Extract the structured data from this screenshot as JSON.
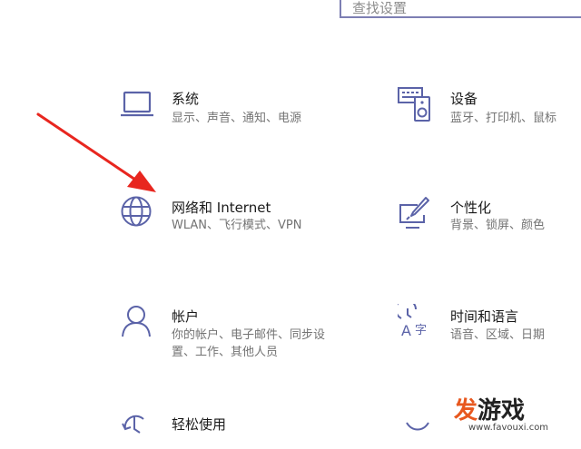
{
  "search": {
    "placeholder": "查找设置"
  },
  "tiles": [
    {
      "title": "系统",
      "desc": [
        "显示、声音、通知、电源"
      ]
    },
    {
      "title": "设备",
      "desc": [
        "蓝牙、打印机、鼠标"
      ]
    },
    {
      "title": "网络和 Internet",
      "desc": [
        "WLAN、飞行模式、VPN"
      ]
    },
    {
      "title": "个性化",
      "desc": [
        "背景、锁屏、颜色"
      ]
    },
    {
      "title": "帐户",
      "desc": [
        "你的帐户、电子邮件、同步设",
        "置、工作、其他人员"
      ]
    },
    {
      "title": "时间和语言",
      "desc": [
        "语音、区域、日期"
      ]
    },
    {
      "title": "轻松使用",
      "desc": []
    }
  ],
  "watermark": {
    "brand_first": "发",
    "brand_rest": "游戏",
    "url": "www.favouxi.com"
  },
  "colors": {
    "icon": "#5b63a8",
    "arrow": "#e8261f",
    "search_border": "#7d7fb3"
  }
}
